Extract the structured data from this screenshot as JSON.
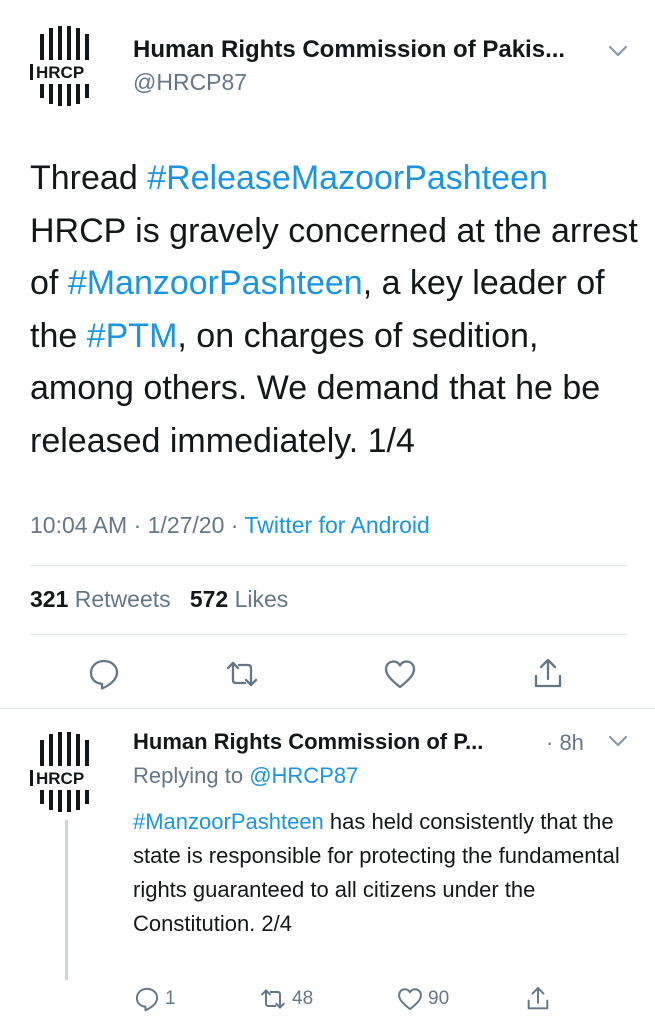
{
  "main_tweet": {
    "avatar": {
      "logo_text": "HRCP"
    },
    "author_name": "Human Rights Commission of Pakis...",
    "handle": "@HRCP87",
    "text_parts": [
      {
        "type": "text",
        "value": "Thread "
      },
      {
        "type": "hashtag",
        "value": "#ReleaseMazoorPashteen"
      },
      {
        "type": "text",
        "value": " HRCP is gravely concerned at the arrest of "
      },
      {
        "type": "hashtag",
        "value": "#ManzoorPashteen"
      },
      {
        "type": "text",
        "value": ", a key leader of the "
      },
      {
        "type": "hashtag",
        "value": "#PTM"
      },
      {
        "type": "text",
        "value": ", on charges of sedition, among others. We demand that he be released immediately. 1/4"
      }
    ],
    "time": "10:04 AM",
    "separator": "·",
    "date": "1/27/20",
    "source": "Twitter for Android",
    "retweets_count": "321",
    "retweets_label": "Retweets",
    "likes_count": "572",
    "likes_label": "Likes",
    "actions": [
      "reply-icon",
      "retweet-icon",
      "like-icon",
      "share-icon"
    ]
  },
  "reply_tweet": {
    "avatar": {
      "logo_text": "HRCP"
    },
    "author_name": "Human Rights Commission of P...",
    "time": "· 8h",
    "replying_prefix": "Replying to",
    "replying_handle": "@HRCP87",
    "text_parts": [
      {
        "type": "hashtag",
        "value": "#ManzoorPashteen"
      },
      {
        "type": "text",
        "value": " has held consistently that the state is responsible for protecting the fundamental rights guaranteed to all citizens under the Constitution. 2/4"
      }
    ],
    "reply_count": "1",
    "retweet_count": "48",
    "like_count": "90"
  },
  "colors": {
    "link": "#1b95e0",
    "secondary": "#657786",
    "primary_text": "#14171a",
    "divider": "#e1e8ed"
  }
}
